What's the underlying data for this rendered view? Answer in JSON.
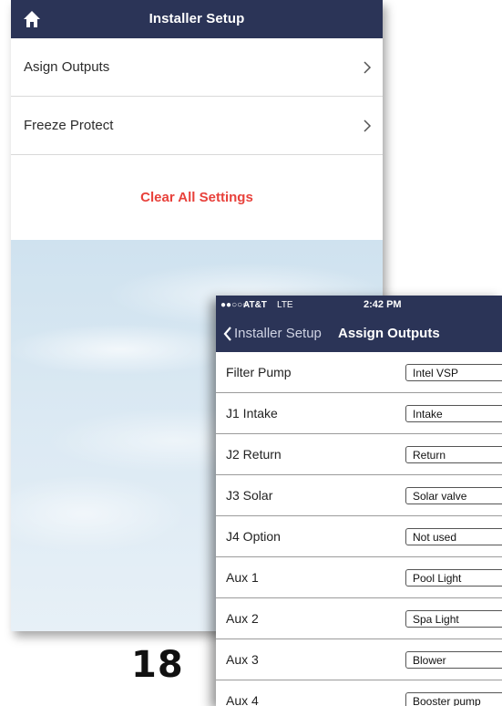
{
  "installer_setup": {
    "title": "Installer Setup",
    "home_icon": "home-icon",
    "items": [
      {
        "label": "Asign Outputs",
        "icon": "chevron-right-icon"
      },
      {
        "label": "Freeze Protect",
        "icon": "chevron-right-icon"
      }
    ],
    "clear_label": "Clear All Settings",
    "clear_color": "#e8413b",
    "nav_color": "#2b3457"
  },
  "page_number": "18",
  "assign_outputs": {
    "status": {
      "signal": "●●○○○",
      "carrier": "AT&T",
      "network": "LTE",
      "time": "2:42 PM"
    },
    "back_label": "Installer Setup",
    "title": "Assign Outputs",
    "rows": [
      {
        "label": "Filter Pump",
        "value": "Intel VSP"
      },
      {
        "label": "J1 Intake",
        "value": "Intake"
      },
      {
        "label": "J2 Return",
        "value": "Return"
      },
      {
        "label": "J3 Solar",
        "value": "Solar valve"
      },
      {
        "label": "J4 Option",
        "value": "Not used"
      },
      {
        "label": "Aux 1",
        "value": "Pool Light"
      },
      {
        "label": "Aux 2",
        "value": "Spa Light"
      },
      {
        "label": "Aux 3",
        "value": "Blower"
      },
      {
        "label": "Aux 4",
        "value": "Booster pump"
      }
    ]
  }
}
